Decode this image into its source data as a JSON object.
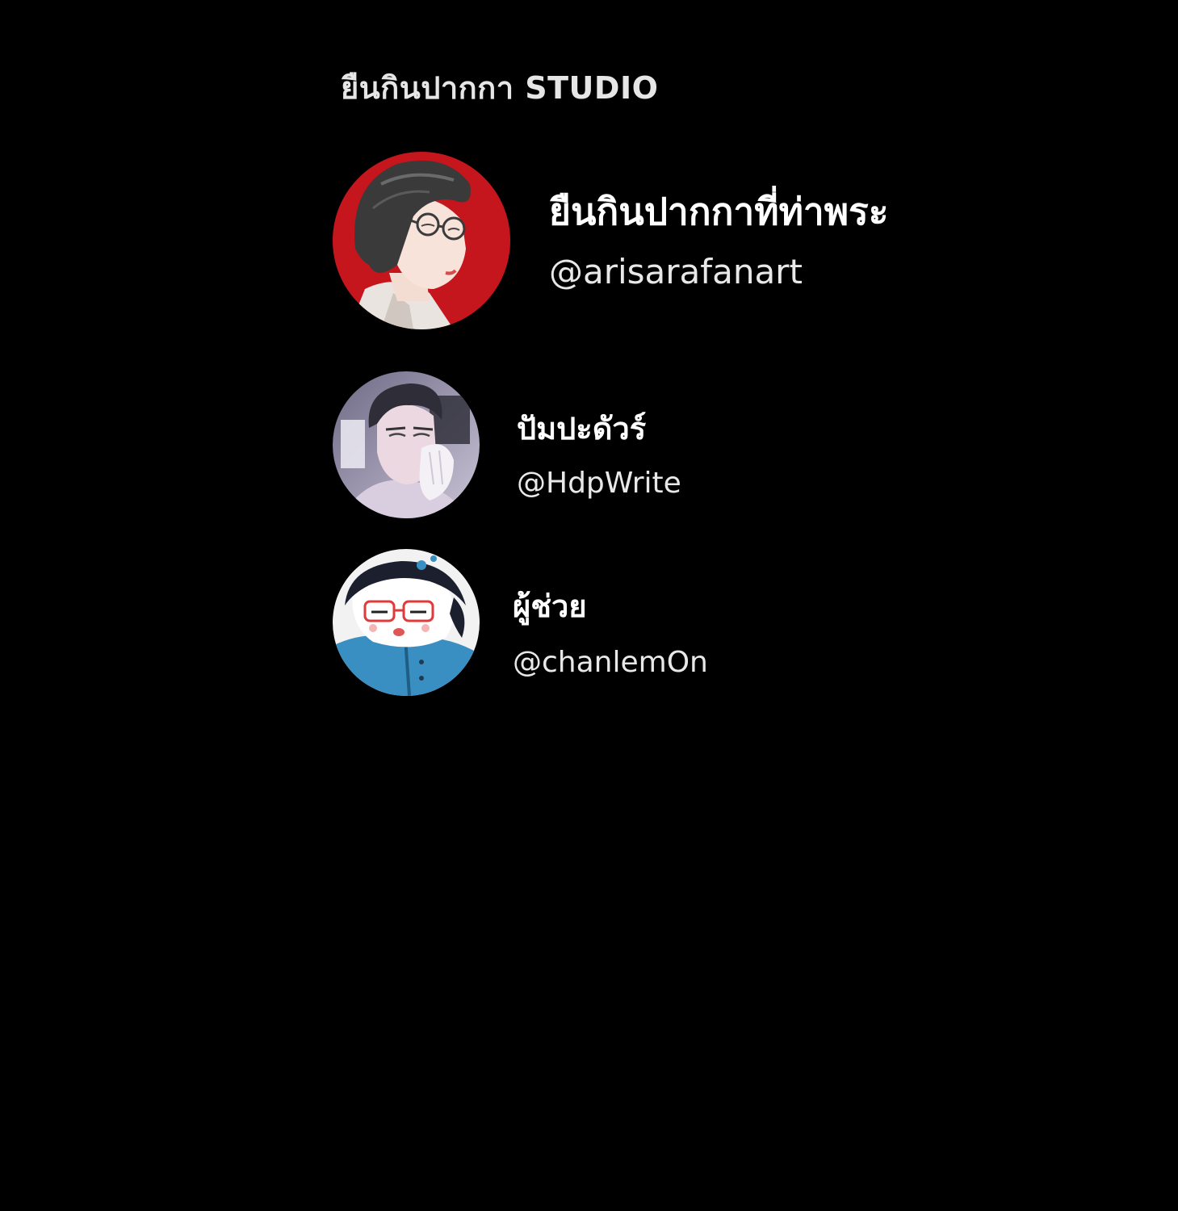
{
  "studio": {
    "title": "ยืนกินปากกา STUDIO"
  },
  "credits": [
    {
      "name": "ยืนกินปากกาที่ท่าพระ",
      "handle": "@arisarafanart",
      "avatar_icon": "avatar-man-glasses-icon",
      "avatar_background": "#c4161c"
    },
    {
      "name": "ปัมปะดัวร์",
      "handle": "@HdpWrite",
      "avatar_icon": "avatar-man-hand-on-face-icon",
      "avatar_background": "#8f8aa4"
    },
    {
      "name": "ผู้ช่วย",
      "handle": "@chanlemOn",
      "avatar_icon": "avatar-cartoon-girl-glasses-icon",
      "avatar_background": "#f2f2f2"
    }
  ],
  "colors": {
    "background": "#000000",
    "text": "#ffffff"
  }
}
